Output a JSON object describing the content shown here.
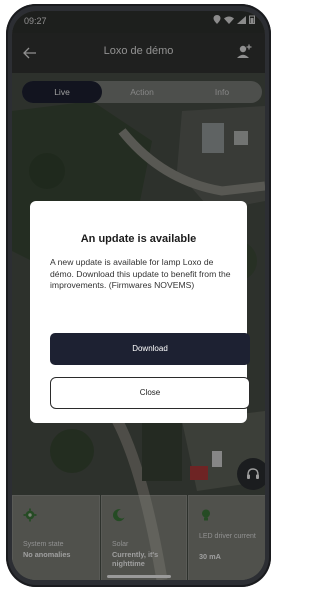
{
  "status_bar": {
    "time": "09:27",
    "icons": [
      "app-notification-icon",
      "signal-icon",
      "location-icon",
      "wifi-icon",
      "cellular-icon",
      "battery-icon"
    ]
  },
  "app_bar": {
    "title": "Loxo de démo",
    "back_icon": "back-arrow-icon",
    "person_icon": "person-add-icon"
  },
  "tabs": [
    {
      "label": "Live",
      "active": true
    },
    {
      "label": "Action",
      "active": false
    },
    {
      "label": "Info",
      "active": false
    }
  ],
  "dialog": {
    "title": "An update is available",
    "message": "A new update is available for lamp Loxo de démo. Download this update to benefit from the improvements. (Firmwares NOVEMS)",
    "download_label": "Download",
    "close_label": "Close"
  },
  "cards": [
    {
      "icon": "gear-icon",
      "label": "System state",
      "value": "No anomalies"
    },
    {
      "icon": "moon-icon",
      "label": "Solar",
      "value": "Currently, it's nighttime"
    },
    {
      "icon": "lightbulb-icon",
      "label": "LED driver current",
      "value": "30 mA"
    }
  ],
  "colors": {
    "primary": "#1d2132",
    "accent_green": "#3c7a3a",
    "dialog_bg": "#ffffff"
  }
}
